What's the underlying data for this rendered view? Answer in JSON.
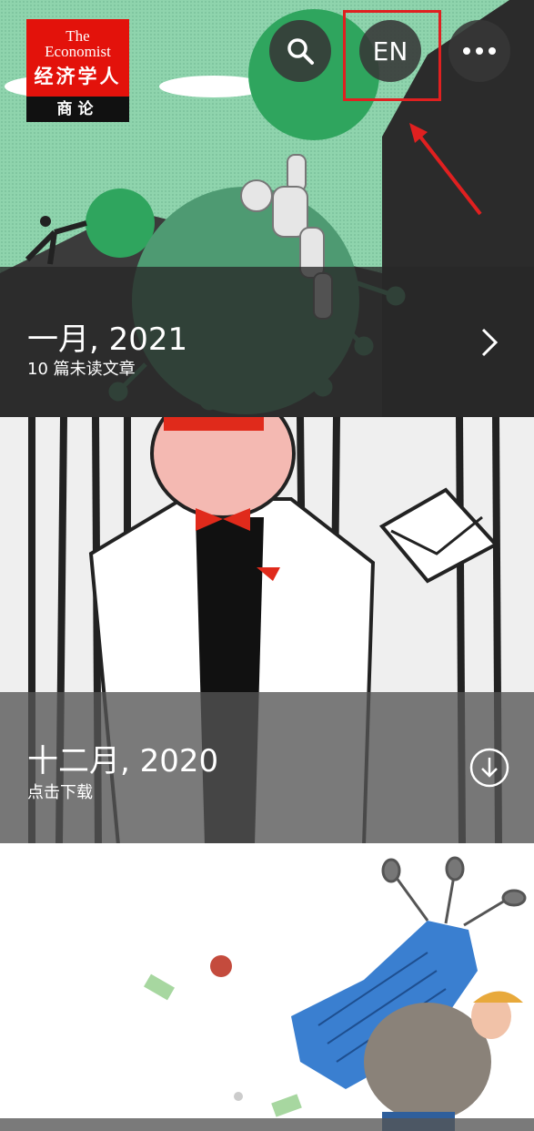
{
  "brand": {
    "line1": "The",
    "line2": "Economist",
    "cn_name": "经济学人",
    "sub": "商论"
  },
  "header": {
    "search_icon": "search-icon",
    "language_label": "EN",
    "more_icon": "more-horizontal-icon"
  },
  "issues": [
    {
      "title": "一月, 2021",
      "subtitle": "10 篇未读文章",
      "action_icon": "chevron-right-icon"
    },
    {
      "title": "十二月, 2020",
      "subtitle": "点击下载",
      "action_icon": "download-circle-icon"
    },
    {
      "title": "",
      "subtitle": ""
    }
  ],
  "colors": {
    "accent_red": "#e3120b",
    "highlight_red": "#e02020",
    "cover1_green": "#86d2a6",
    "cover3_blue": "#3a7fd0"
  }
}
